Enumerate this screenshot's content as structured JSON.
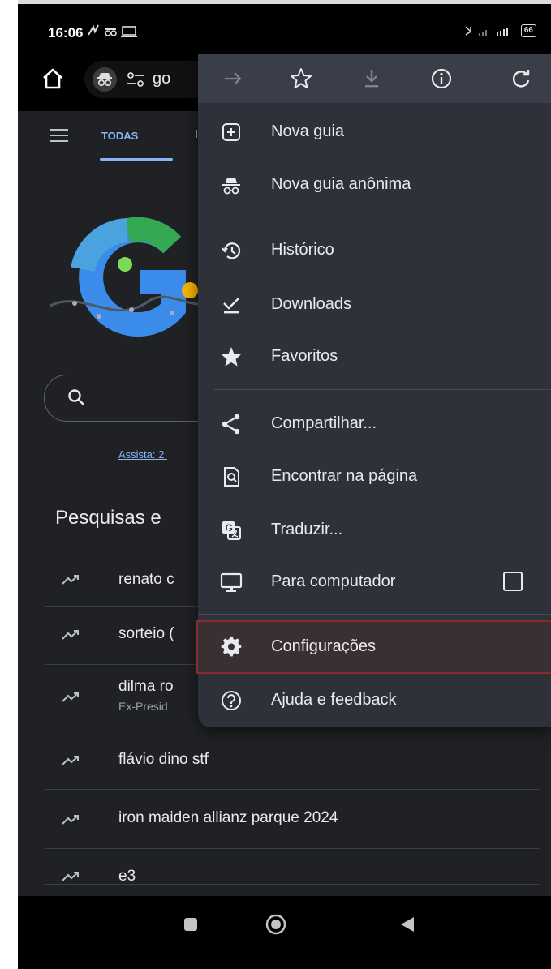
{
  "status_bar": {
    "time": "16:06",
    "battery": "66"
  },
  "toolbar": {
    "url_text": "go"
  },
  "tabs": {
    "active_label": "TODAS"
  },
  "assista_link": "Assista: 2 ",
  "trending": {
    "title": "Pesquisas e",
    "items": [
      {
        "text": "renato c",
        "subtitle": ""
      },
      {
        "text": "sorteio (",
        "subtitle": ""
      },
      {
        "text": "dilma ro",
        "subtitle": "Ex-Presid"
      },
      {
        "text": "flávio dino stf",
        "subtitle": ""
      },
      {
        "text": "iron maiden allianz parque 2024",
        "subtitle": ""
      },
      {
        "text": "e3",
        "subtitle": ""
      }
    ]
  },
  "menu": {
    "icon_row": [
      "forward-icon",
      "star-icon",
      "download-icon",
      "info-icon",
      "reload-icon"
    ],
    "items": [
      {
        "label": "Nova guia",
        "icon": "plus-box-icon"
      },
      {
        "label": "Nova guia anônima",
        "icon": "incognito-icon"
      },
      {
        "label": "Histórico",
        "icon": "history-icon"
      },
      {
        "label": "Downloads",
        "icon": "download-check-icon"
      },
      {
        "label": "Favoritos",
        "icon": "star-filled-icon"
      },
      {
        "label": "Compartilhar...",
        "icon": "share-icon"
      },
      {
        "label": "Encontrar na página",
        "icon": "find-in-page-icon"
      },
      {
        "label": "Traduzir...",
        "icon": "translate-icon"
      },
      {
        "label": "Para computador",
        "icon": "desktop-icon",
        "checkbox": false
      },
      {
        "label": "Configurações",
        "icon": "gear-icon",
        "highlighted": true
      },
      {
        "label": "Ajuda e feedback",
        "icon": "help-icon"
      }
    ]
  },
  "colors": {
    "background": "#202124",
    "menu": "#2e3139",
    "accent": "#8ab4f8",
    "highlight_border": "#8a2a31"
  }
}
